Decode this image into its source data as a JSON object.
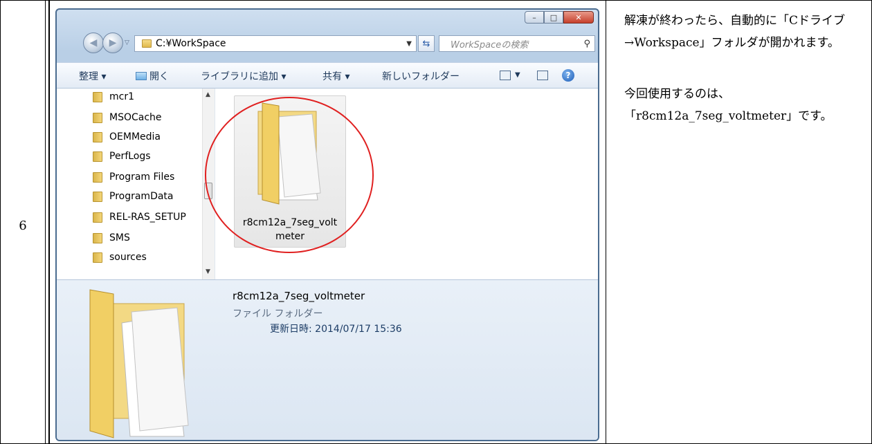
{
  "step_number": "6",
  "description": {
    "paragraph_1": "解凍が終わったら、自動的に「Cドライブ→Workspace」フォルダが開かれます。",
    "paragraph_2": "今回使用するのは、「r8cm12a_7seg_voltmeter」です。"
  },
  "explorer": {
    "window_buttons": {
      "minimize": "–",
      "maximize": "□",
      "close": "✕"
    },
    "address": "C:¥WorkSpace",
    "search_placeholder": "WorkSpaceの検索",
    "toolbar": {
      "organize": "整理 ▾",
      "open": "開く",
      "add_to_library": "ライブラリに追加 ▾",
      "share": "共有 ▾",
      "new_folder": "新しいフォルダー"
    },
    "tree_items": [
      "mcr1",
      "MSOCache",
      "OEMMedia",
      "PerfLogs",
      "Program Files",
      "ProgramData",
      "REL-RAS_SETUP",
      "SMS",
      "sources"
    ],
    "selected_file": {
      "label_line1": "r8cm12a_7seg_volt",
      "label_line2": "meter"
    },
    "details": {
      "name": "r8cm12a_7seg_voltmeter",
      "type": "ファイル フォルダー",
      "modified": "更新日時: 2014/07/17 15:36"
    }
  },
  "colors": {
    "highlight_circle": "#e02020",
    "frame_chrome": "#b9cfe6",
    "folder_yellow": "#f4d67a"
  }
}
